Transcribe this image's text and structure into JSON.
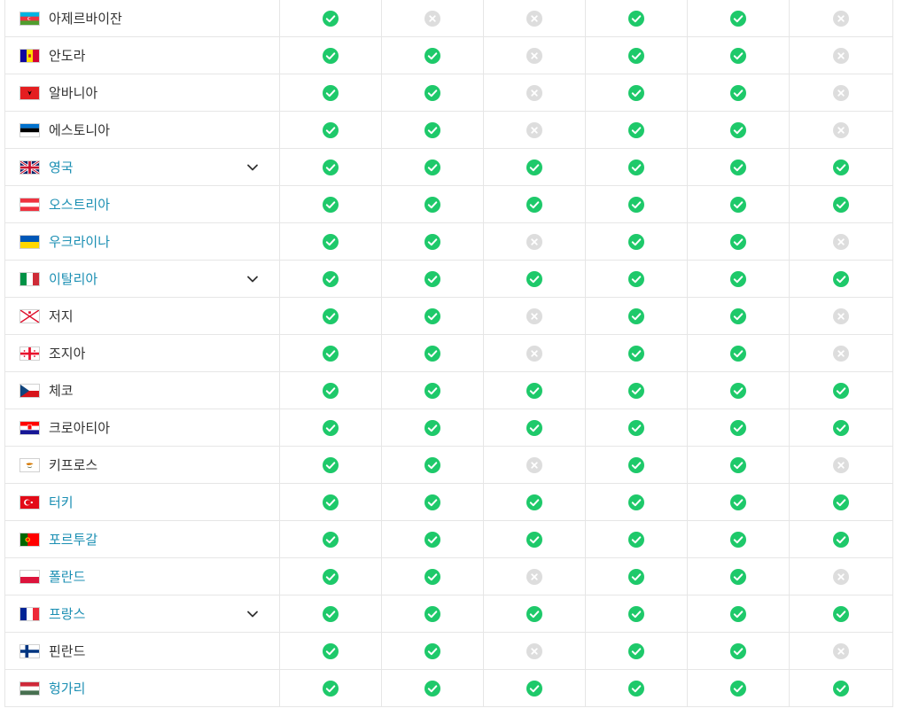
{
  "colors": {
    "yes": "#1ec96a",
    "no": "#dddddd",
    "link": "#1b8fb3",
    "text": "#333333"
  },
  "rows": [
    {
      "name": "아제르바이잔",
      "flag": "az",
      "link": false,
      "expand": false,
      "cells": [
        1,
        0,
        0,
        1,
        1,
        0
      ]
    },
    {
      "name": "안도라",
      "flag": "ad",
      "link": false,
      "expand": false,
      "cells": [
        1,
        1,
        0,
        1,
        1,
        0
      ]
    },
    {
      "name": "알바니아",
      "flag": "al",
      "link": false,
      "expand": false,
      "cells": [
        1,
        1,
        0,
        1,
        1,
        0
      ]
    },
    {
      "name": "에스토니아",
      "flag": "ee",
      "link": false,
      "expand": false,
      "cells": [
        1,
        1,
        0,
        1,
        1,
        0
      ]
    },
    {
      "name": "영국",
      "flag": "gb",
      "link": true,
      "expand": true,
      "cells": [
        1,
        1,
        1,
        1,
        1,
        1
      ]
    },
    {
      "name": "오스트리아",
      "flag": "at",
      "link": true,
      "expand": false,
      "cells": [
        1,
        1,
        1,
        1,
        1,
        1
      ]
    },
    {
      "name": "우크라이나",
      "flag": "ua",
      "link": true,
      "expand": false,
      "cells": [
        1,
        1,
        0,
        1,
        1,
        0
      ]
    },
    {
      "name": "이탈리아",
      "flag": "it",
      "link": true,
      "expand": true,
      "cells": [
        1,
        1,
        1,
        1,
        1,
        1
      ]
    },
    {
      "name": "저지",
      "flag": "je",
      "link": false,
      "expand": false,
      "cells": [
        1,
        1,
        0,
        1,
        1,
        0
      ]
    },
    {
      "name": "조지아",
      "flag": "ge",
      "link": false,
      "expand": false,
      "cells": [
        1,
        1,
        0,
        1,
        1,
        0
      ]
    },
    {
      "name": "체코",
      "flag": "cz",
      "link": false,
      "expand": false,
      "cells": [
        1,
        1,
        1,
        1,
        1,
        1
      ]
    },
    {
      "name": "크로아티아",
      "flag": "hr",
      "link": false,
      "expand": false,
      "cells": [
        1,
        1,
        1,
        1,
        1,
        1
      ]
    },
    {
      "name": "키프로스",
      "flag": "cy",
      "link": false,
      "expand": false,
      "cells": [
        1,
        1,
        0,
        1,
        1,
        0
      ]
    },
    {
      "name": "터키",
      "flag": "tr",
      "link": true,
      "expand": false,
      "cells": [
        1,
        1,
        1,
        1,
        1,
        1
      ]
    },
    {
      "name": "포르투갈",
      "flag": "pt",
      "link": true,
      "expand": false,
      "cells": [
        1,
        1,
        1,
        1,
        1,
        1
      ]
    },
    {
      "name": "폴란드",
      "flag": "pl",
      "link": true,
      "expand": false,
      "cells": [
        1,
        1,
        0,
        1,
        1,
        0
      ]
    },
    {
      "name": "프랑스",
      "flag": "fr",
      "link": true,
      "expand": true,
      "cells": [
        1,
        1,
        1,
        1,
        1,
        1
      ]
    },
    {
      "name": "핀란드",
      "flag": "fi",
      "link": false,
      "expand": false,
      "cells": [
        1,
        1,
        0,
        1,
        1,
        0
      ]
    },
    {
      "name": "헝가리",
      "flag": "hu",
      "link": true,
      "expand": false,
      "cells": [
        1,
        1,
        1,
        1,
        1,
        1
      ]
    }
  ]
}
